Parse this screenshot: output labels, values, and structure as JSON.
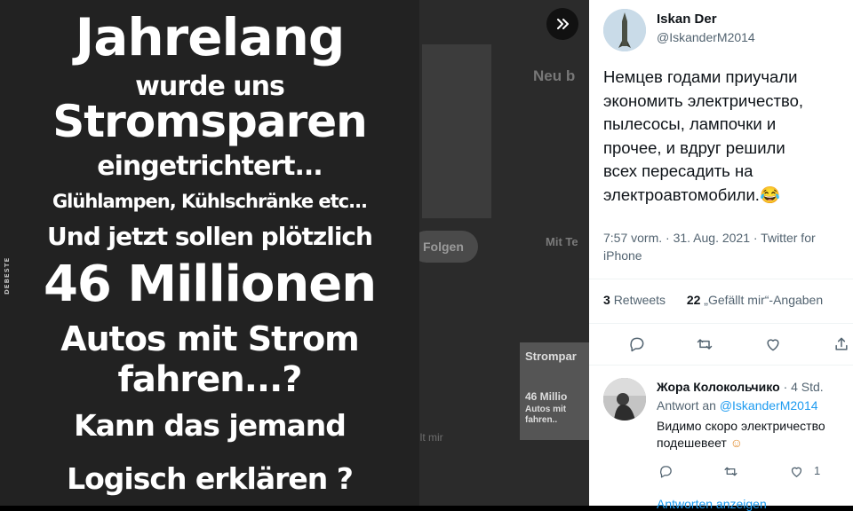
{
  "poster": {
    "lines": [
      "Jahrelang",
      "wurde uns",
      "Stromsparen",
      "eingetrichtert...",
      "Glühlampen, Kühlschränke etc...",
      "Und jetzt sollen plötzlich",
      "46 Millionen",
      "Autos mit Strom",
      "fahren...?",
      "Kann das jemand",
      "Logisch erklären ?"
    ],
    "side_credit": "DEBESTE"
  },
  "background": {
    "heading": "Neu b",
    "follow_label": "Folgen",
    "section": "Mit Te",
    "snippet": "llt mir",
    "thumb_lines": [
      "Strompar",
      "46 Millio",
      "Autos mit",
      "fahren.."
    ]
  },
  "tweet": {
    "author_name": "Iskan Der",
    "author_handle": "@IskanderM2014",
    "text_lines": [
      "Немцев годами приучали",
      "экономить электричество,",
      "пылесосы, лампочки и",
      "прочее, и вдруг решили",
      "всех пересадить на",
      "электроавтомобили."
    ],
    "emoji": "😂",
    "meta_line1": "7:57 vorm. · 31. Aug. 2021 · Twitter for",
    "meta_line2": "iPhone",
    "retweets_count": "3",
    "retweets_label": "Retweets",
    "likes_count": "22",
    "likes_label": "„Gefällt mir“-Angaben"
  },
  "reply": {
    "author_name": "Жора Колокольчико",
    "time": "· 4 Std.",
    "reply_prefix": "Antwort an",
    "reply_to": "@IskanderM2014",
    "text_lines": [
      "Видимо скоро электричество",
      "подешевеет"
    ],
    "emoji": "☺",
    "like_count": "1",
    "show_replies": "Antworten anzeigen"
  },
  "colors": {
    "accent": "#1d9bf0",
    "muted": "#536471"
  }
}
